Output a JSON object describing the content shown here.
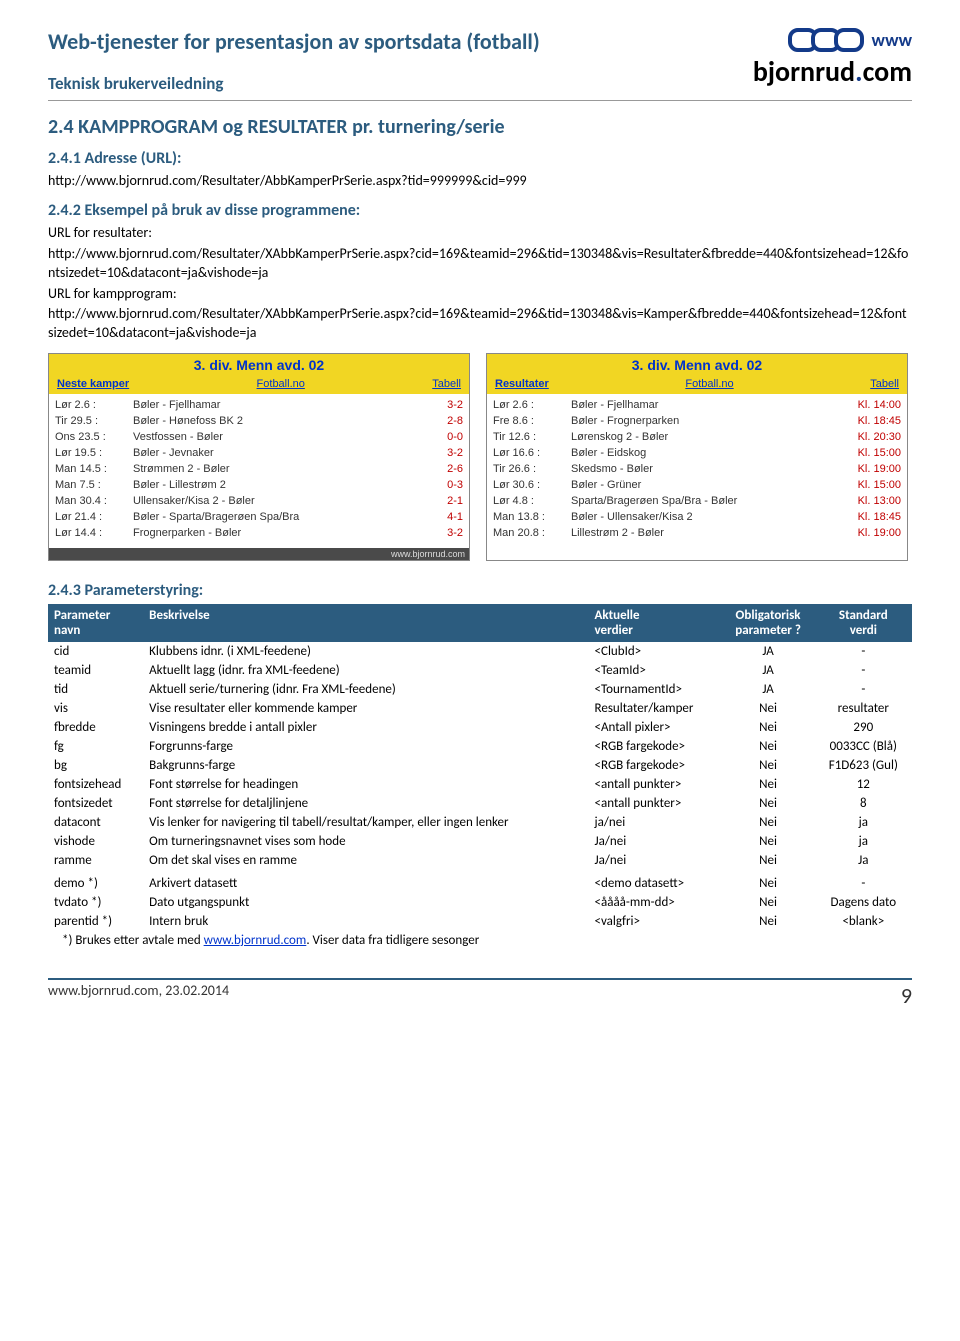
{
  "header": {
    "title": "Web-tjenester for presentasjon av sportsdata (fotball)",
    "subtitle": "Teknisk brukerveiledning",
    "logo_www": "www",
    "logo_brand_pre": "bjornrud",
    "logo_brand_post": "com"
  },
  "section": {
    "h2": "2.4  KAMPPROGRAM og RESULTATER pr. turnering/serie",
    "h3a": "2.4.1  Adresse (URL):",
    "url1": "http://www.bjornrud.com/Resultater/AbbKamperPrSerie.aspx?tid=999999&cid=999",
    "h3b": "2.4.2  Eksempel på bruk av disse programmene:",
    "label_res": "URL for resultater:",
    "url2": "http://www.bjornrud.com/Resultater/XAbbKamperPrSerie.aspx?cid=169&teamid=296&tid=130348&vis=Resultater&fbredde=440&fontsizehead=12&fontsizedet=10&datacont=ja&vishode=ja",
    "label_kamp": "URL for kampprogram:",
    "url3": "http://www.bjornrud.com/Resultater/XAbbKamperPrSerie.aspx?cid=169&teamid=296&tid=130348&vis=Kamper&fbredde=440&fontsizehead=12&fontsizedet=10&datacont=ja&vishode=ja",
    "h3c": "2.4.3  Parameterstyring:"
  },
  "widget_left": {
    "title": "3. div. Menn avd. 02",
    "tab_active": "Neste kamper",
    "tab2": "Fotball.no",
    "tab3": "Tabell",
    "rows": [
      {
        "c1": "Lør 2.6 :",
        "c2": "Bøler - Fjellhamar",
        "c3": "3-2"
      },
      {
        "c1": "Tir 29.5 :",
        "c2": "Bøler - Hønefoss BK 2",
        "c3": "2-8"
      },
      {
        "c1": "Ons 23.5 :",
        "c2": "Vestfossen - Bøler",
        "c3": "0-0"
      },
      {
        "c1": "Lør 19.5 :",
        "c2": "Bøler - Jevnaker",
        "c3": "3-2"
      },
      {
        "c1": "Man 14.5 :",
        "c2": "Strømmen 2 - Bøler",
        "c3": "2-6"
      },
      {
        "c1": "Man 7.5 :",
        "c2": "Bøler - Lillestrøm 2",
        "c3": "0-3"
      },
      {
        "c1": "Man 30.4 :",
        "c2": "Ullensaker/Kisa 2 - Bøler",
        "c3": "2-1"
      },
      {
        "c1": "Lør 21.4 :",
        "c2": "Bøler - Sparta/Bragerøen Spa/Bra",
        "c3": "4-1"
      },
      {
        "c1": "Lør 14.4 :",
        "c2": "Frognerparken - Bøler",
        "c3": "3-2"
      }
    ],
    "foot": "www.bjornrud.com"
  },
  "widget_right": {
    "title": "3. div. Menn avd. 02",
    "tab_active": "Resultater",
    "tab2": "Fotball.no",
    "tab3": "Tabell",
    "rows": [
      {
        "c1": "Lør 2.6 :",
        "c2": "Bøler - Fjellhamar",
        "c3": "Kl. 14:00"
      },
      {
        "c1": "Fre 8.6 :",
        "c2": "Bøler - Frognerparken",
        "c3": "Kl. 18:45"
      },
      {
        "c1": "Tir 12.6 :",
        "c2": "Lørenskog 2 - Bøler",
        "c3": "Kl. 20:30"
      },
      {
        "c1": "Lør 16.6 :",
        "c2": "Bøler - Eidskog",
        "c3": "Kl. 15:00"
      },
      {
        "c1": "Tir 26.6 :",
        "c2": "Skedsmo - Bøler",
        "c3": "Kl. 19:00"
      },
      {
        "c1": "Lør 30.6 :",
        "c2": "Bøler - Grüner",
        "c3": "Kl. 15:00"
      },
      {
        "c1": "Lør 4.8 :",
        "c2": "Sparta/Bragerøen Spa/Bra - Bøler",
        "c3": "Kl. 13:00"
      },
      {
        "c1": "Man 13.8 :",
        "c2": "Bøler - Ullensaker/Kisa 2",
        "c3": "Kl. 18:45"
      },
      {
        "c1": "Man 20.8 :",
        "c2": "Lillestrøm 2 - Bøler",
        "c3": "Kl. 19:00"
      }
    ]
  },
  "params": {
    "headers": {
      "c1a": "Parameter",
      "c1b": "navn",
      "c2": "Beskrivelse",
      "c3a": "Aktuelle",
      "c3b": "verdier",
      "c4a": "Obligatorisk",
      "c4b": "parameter ?",
      "c5a": "Standard",
      "c5b": "verdi"
    },
    "rows": [
      {
        "p": "cid",
        "b": "Klubbens idnr. (i XML-feedene)",
        "v": "<ClubId>",
        "o": "JA",
        "s": "-"
      },
      {
        "p": "teamid",
        "b": "Aktuellt lagg (idnr. fra XML-feedene)",
        "v": "<TeamId>",
        "o": "JA",
        "s": "-"
      },
      {
        "p": "tid",
        "b": "Aktuell serie/turnering (idnr. Fra XML-feedene)",
        "v": "<TournamentId>",
        "o": "JA",
        "s": "-"
      },
      {
        "p": "vis",
        "b": "Vise resultater eller kommende kamper",
        "v": "Resultater/kamper",
        "o": "Nei",
        "s": "resultater"
      },
      {
        "p": "fbredde",
        "b": "Visningens bredde i antall pixler",
        "v": "<Antall pixler>",
        "o": "Nei",
        "s": "290"
      },
      {
        "p": "fg",
        "b": "Forgrunns-farge",
        "v": "<RGB fargekode>",
        "o": "Nei",
        "s": "0033CC  (Blå)"
      },
      {
        "p": "bg",
        "b": "Bakgrunns-farge",
        "v": "<RGB fargekode>",
        "o": "Nei",
        "s": "F1D623 (Gul)"
      },
      {
        "p": "fontsizehead",
        "b": "Font størrelse for headingen",
        "v": "<antall punkter>",
        "o": "Nei",
        "s": "12"
      },
      {
        "p": "fontsizedet",
        "b": "Font størrelse for detaljlinjene",
        "v": "<antall punkter>",
        "o": "Nei",
        "s": "8"
      },
      {
        "p": "datacont",
        "b": "Vis lenker for navigering til tabell/resultat/kamper, eller ingen lenker",
        "v": "ja/nei",
        "o": "Nei",
        "s": "ja"
      },
      {
        "p": "vishode",
        "b": "Om turneringsnavnet vises som hode",
        "v": "Ja/nei",
        "o": "Nei",
        "s": "ja"
      },
      {
        "p": "ramme",
        "b": "Om det skal vises en ramme",
        "v": "Ja/nei",
        "o": "Nei",
        "s": "Ja"
      },
      {
        "p": "",
        "b": "",
        "v": "",
        "o": "",
        "s": ""
      },
      {
        "p": "demo  *)",
        "b": "Arkivert datasett",
        "v": "<demo datasett>",
        "o": "Nei",
        "s": "-"
      },
      {
        "p": "tvdato *)",
        "b": "Dato utgangspunkt",
        "v": "<åååå-mm-dd>",
        "o": "Nei",
        "s": "Dagens dato"
      },
      {
        "p": "parentid *)",
        "b": "Intern bruk",
        "v": "<valgfri>",
        "o": "Nei",
        "s": "<blank>"
      }
    ]
  },
  "footnote": {
    "pre": "*) Brukes etter avtale med ",
    "link": "www.bjornrud.com",
    "post": ".  Viser data fra tidligere sesonger"
  },
  "footer": {
    "left": "www.bjornrud.com, 23.02.2014",
    "page": "9"
  }
}
